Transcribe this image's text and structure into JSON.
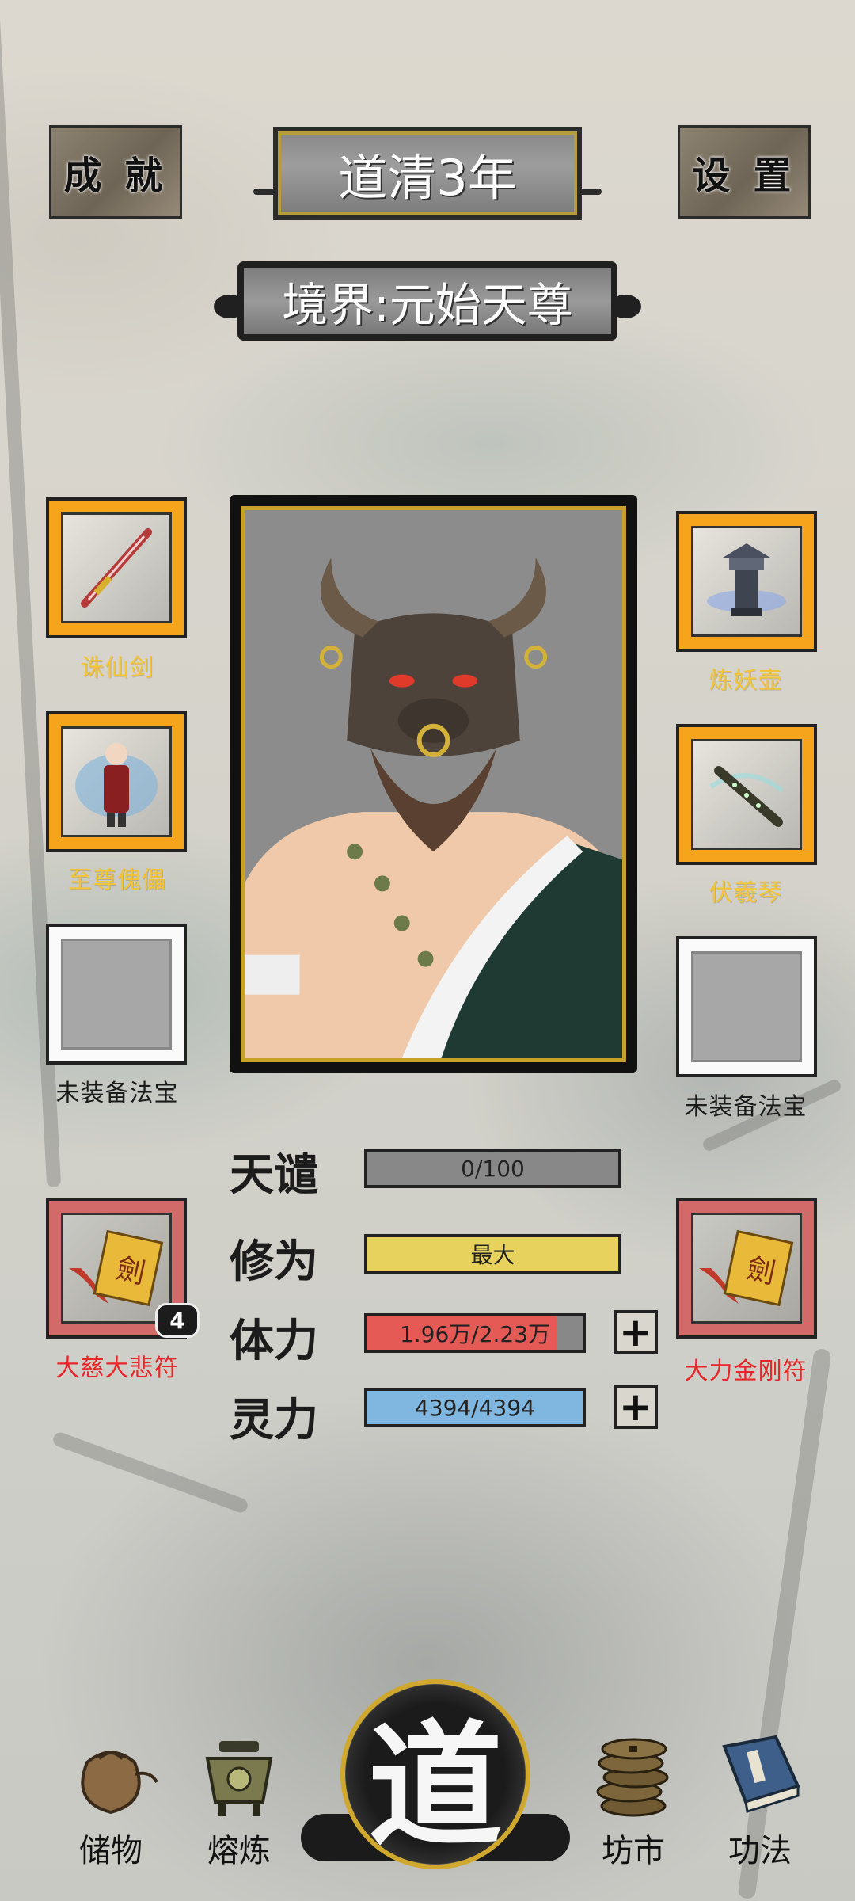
{
  "header": {
    "achievements_label": "成 就",
    "settings_label": "设 置",
    "year_title": "道清3年",
    "realm_title": "境界:元始天尊"
  },
  "left_slots": [
    {
      "label": "诛仙剑",
      "state": "equipped",
      "icon": "sword-icon"
    },
    {
      "label": "至尊傀儡",
      "state": "equipped",
      "icon": "puppet-icon"
    },
    {
      "label": "未装备法宝",
      "state": "empty"
    },
    {
      "label": "大慈大悲符",
      "state": "talisman",
      "icon": "talisman-icon",
      "count": "4"
    }
  ],
  "right_slots": [
    {
      "label": "炼妖壶",
      "state": "equipped",
      "icon": "cauldron-icon"
    },
    {
      "label": "伏羲琴",
      "state": "equipped",
      "icon": "flute-icon"
    },
    {
      "label": "未装备法宝",
      "state": "empty"
    },
    {
      "label": "大力金刚符",
      "state": "talisman",
      "icon": "talisman-icon"
    }
  ],
  "stats": {
    "tianqian": {
      "label": "天谴",
      "value": "0/100",
      "fill": 0.0,
      "color": "#8a8a8a"
    },
    "xiuwei": {
      "label": "修为",
      "value": "最大",
      "fill": 1.0,
      "color": "#e8d25e"
    },
    "tili": {
      "label": "体力",
      "value": "1.96万/2.23万",
      "fill": 0.88,
      "color": "#e65a55"
    },
    "lingli": {
      "label": "灵力",
      "value": "4394/4394",
      "fill": 1.0,
      "color": "#7fb7e0"
    }
  },
  "nav": {
    "storage": "储物",
    "smelt": "熔炼",
    "dao": "道",
    "market": "坊市",
    "skills": "功法"
  }
}
